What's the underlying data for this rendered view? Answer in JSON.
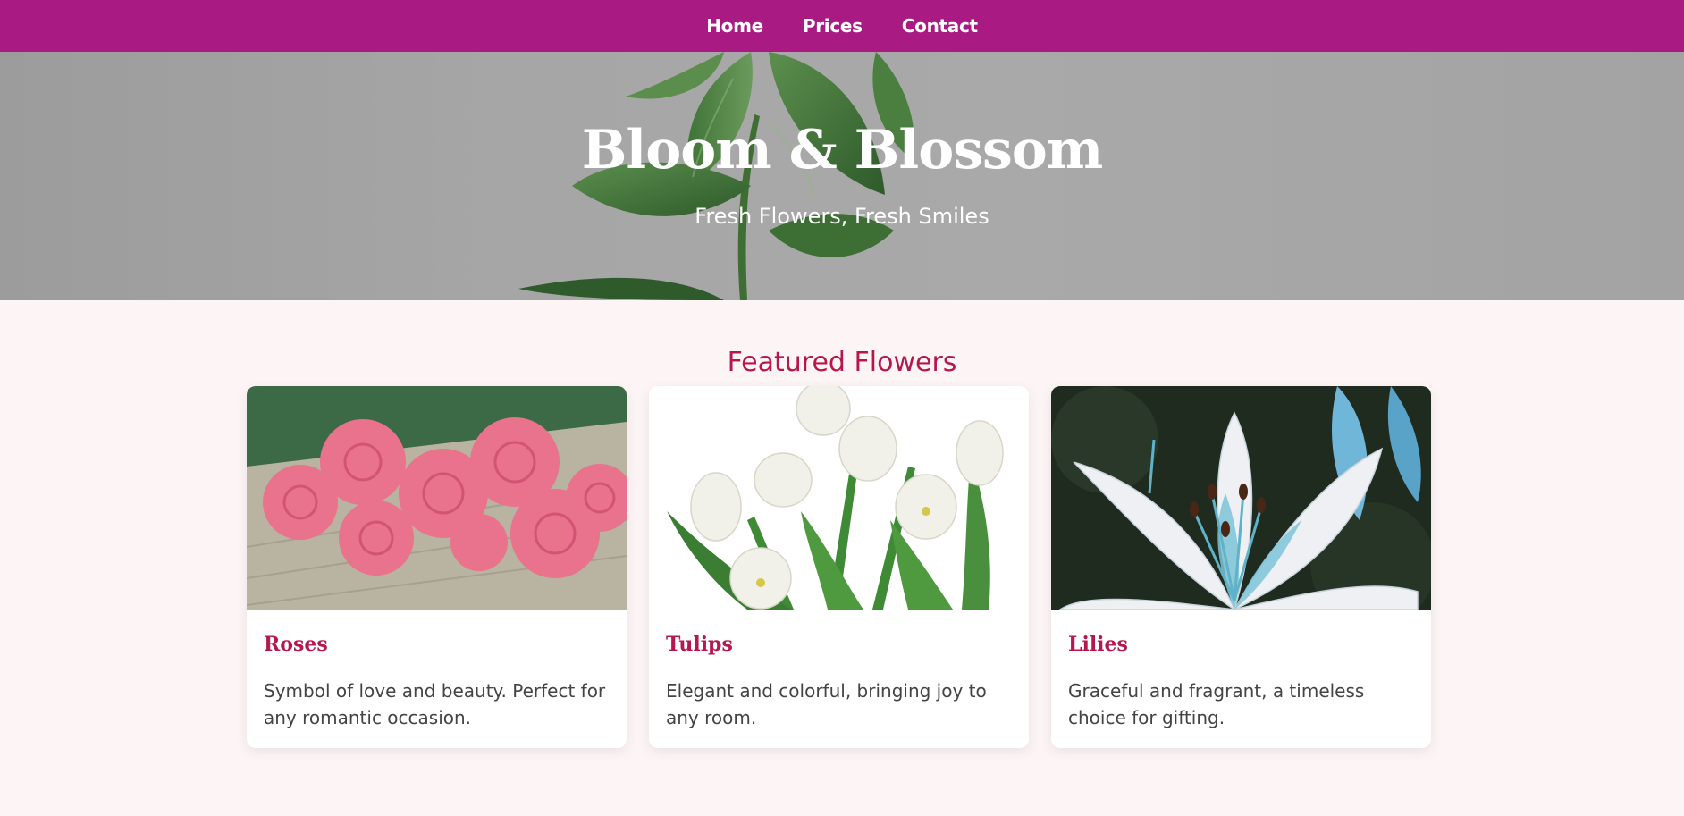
{
  "nav": {
    "items": [
      {
        "label": "Home"
      },
      {
        "label": "Prices"
      },
      {
        "label": "Contact"
      }
    ]
  },
  "hero": {
    "title": "Bloom & Blossom",
    "subtitle": "Fresh Flowers, Fresh Smiles"
  },
  "featured": {
    "heading": "Featured Flowers",
    "cards": [
      {
        "title": "Roses",
        "description": "Symbol of love and beauty. Perfect for any romantic occasion."
      },
      {
        "title": "Tulips",
        "description": "Elegant and colorful, bringing joy to any room."
      },
      {
        "title": "Lilies",
        "description": "Graceful and fragrant, a timeless choice for gifting."
      }
    ]
  },
  "colors": {
    "nav_bg": "#a91b83",
    "accent": "#b5174f",
    "page_bg": "#fdf5f5"
  }
}
